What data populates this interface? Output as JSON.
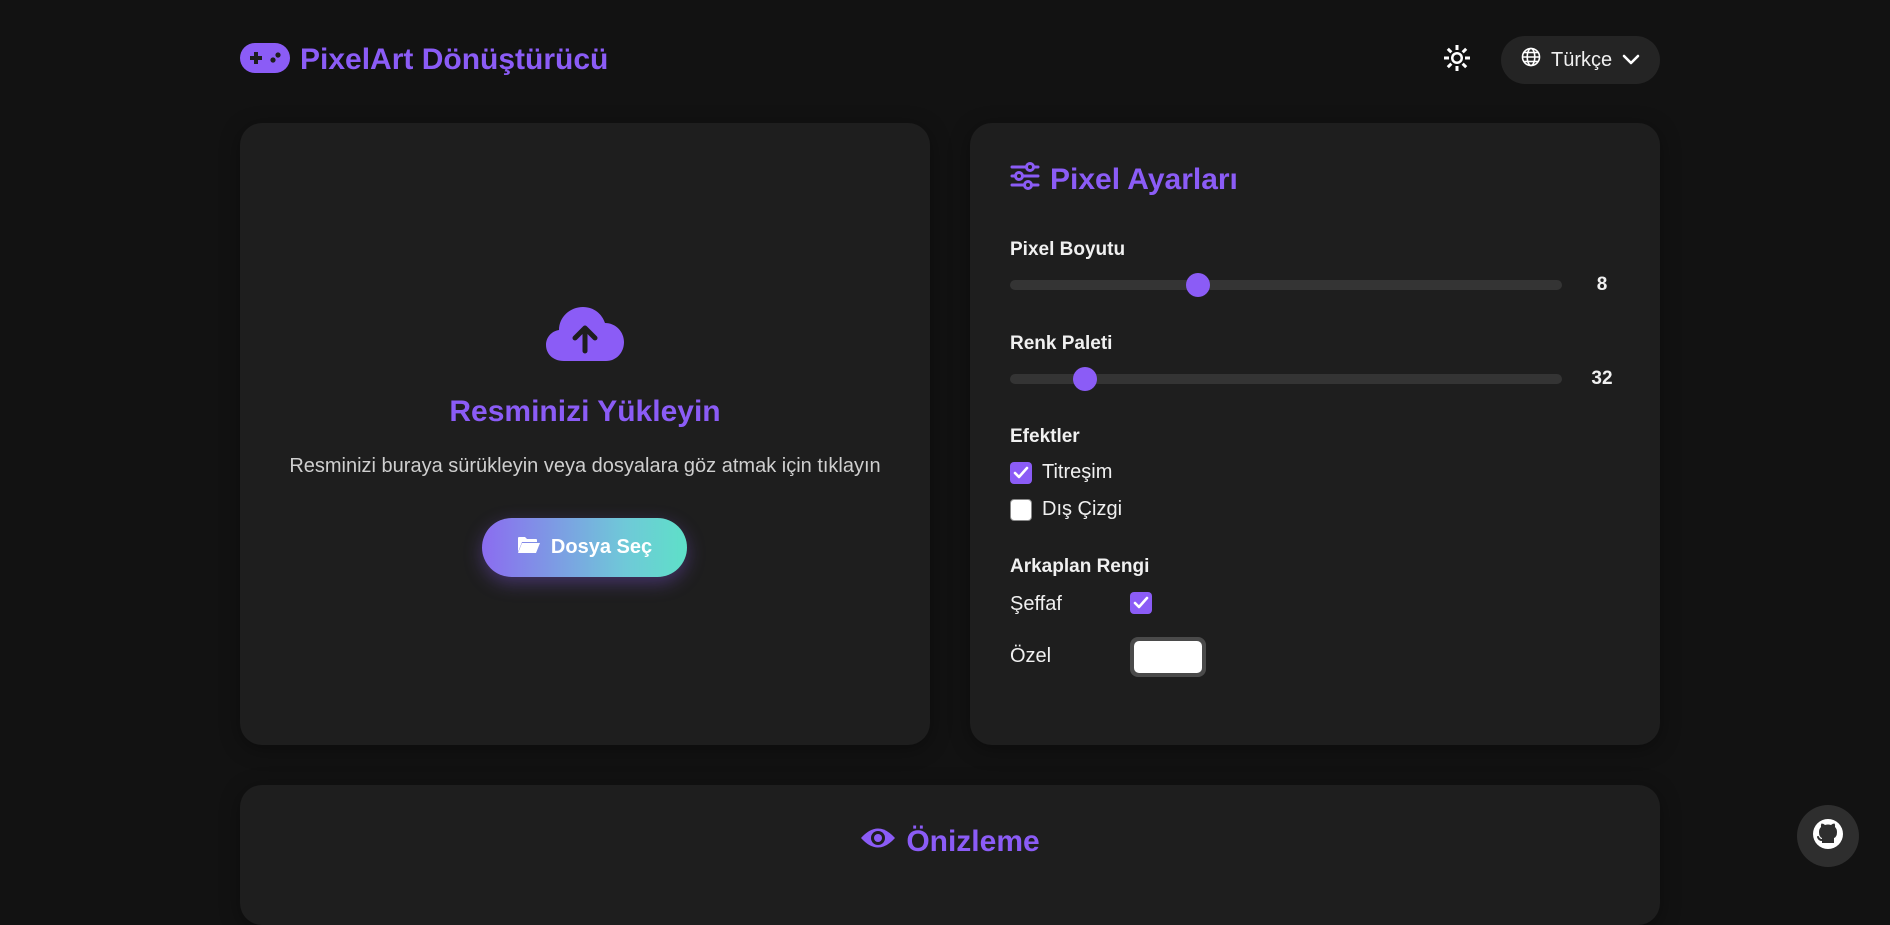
{
  "header": {
    "brand_title": "PixelArt Dönüştürücü",
    "brand_icon": "gamepad-icon",
    "theme_icon": "sun-icon",
    "language": "Türkçe",
    "language_icon": "globe-icon",
    "dropdown_icon": "chevron-down-icon"
  },
  "upload": {
    "icon": "cloud-upload-icon",
    "title": "Resminizi Yükleyin",
    "description": "Resminizi buraya sürükleyin veya dosyalara göz atmak için tıklayın",
    "button_label": "Dosya Seç",
    "button_icon": "folder-open-icon"
  },
  "settings": {
    "title": "Pixel Ayarları",
    "title_icon": "sliders-icon",
    "pixel_size": {
      "label": "Pixel Boyutu",
      "value": "8",
      "fraction": 0.34
    },
    "palette": {
      "label": "Renk Paleti",
      "value": "32",
      "fraction": 0.135
    },
    "effects": {
      "label": "Efektler",
      "items": [
        {
          "label": "Titreşim",
          "checked": true
        },
        {
          "label": "Dış Çizgi",
          "checked": false
        }
      ]
    },
    "background": {
      "label": "Arkaplan Rengi",
      "transparent_label": "Şeffaf",
      "transparent_checked": true,
      "custom_label": "Özel",
      "custom_color": "#ffffff"
    }
  },
  "preview": {
    "title": "Önizleme",
    "icon": "eye-icon"
  },
  "github": {
    "icon": "github-icon"
  },
  "colors": {
    "accent": "#8b5cf6",
    "background": "#121212",
    "card": "#1e1e1e"
  }
}
